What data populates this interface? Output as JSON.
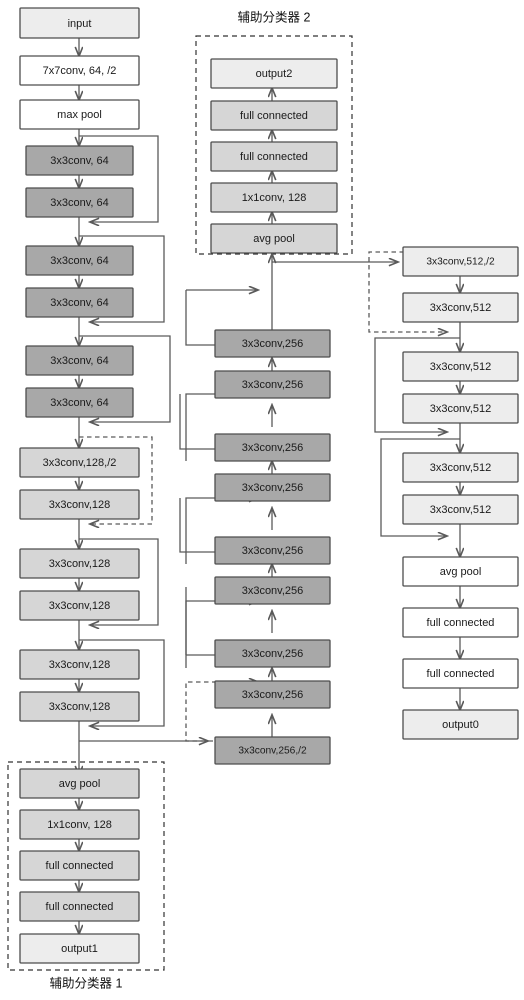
{
  "figure": {
    "type": "neural-network-architecture-diagram",
    "background_color": "#ffffff",
    "colors": {
      "box_light": "#ededed",
      "box_mid": "#d6d6d6",
      "box_dark": "#a8a8a8",
      "box_white": "#ffffff",
      "border": "#4d4d4d",
      "edge": "#5a5a5a",
      "text": "#1a1a1a"
    }
  },
  "titles": {
    "aux2": "辅助分类器 2",
    "aux1": "辅助分类器 1"
  },
  "main_column": {
    "name": "main-backbone-stem",
    "nodes": [
      {
        "id": "input",
        "label": "input",
        "style": "light"
      },
      {
        "id": "conv7x7",
        "label": "7x7conv, 64, /2",
        "style": "white"
      },
      {
        "id": "maxpool",
        "label": "max pool",
        "style": "white"
      },
      {
        "id": "c64_1",
        "label": "3x3conv, 64",
        "style": "dark"
      },
      {
        "id": "c64_2",
        "label": "3x3conv, 64",
        "style": "dark"
      },
      {
        "id": "c64_3",
        "label": "3x3conv, 64",
        "style": "dark"
      },
      {
        "id": "c64_4",
        "label": "3x3conv, 64",
        "style": "dark"
      },
      {
        "id": "c64_5",
        "label": "3x3conv, 64",
        "style": "dark"
      },
      {
        "id": "c64_6",
        "label": "3x3conv, 64",
        "style": "dark"
      },
      {
        "id": "c128_1",
        "label": "3x3conv,128,/2",
        "style": "mid"
      },
      {
        "id": "c128_2",
        "label": "3x3conv,128",
        "style": "mid"
      },
      {
        "id": "c128_3",
        "label": "3x3conv,128",
        "style": "mid"
      },
      {
        "id": "c128_4",
        "label": "3x3conv,128",
        "style": "mid"
      },
      {
        "id": "c128_5",
        "label": "3x3conv,128",
        "style": "mid"
      },
      {
        "id": "c128_6",
        "label": "3x3conv,128",
        "style": "mid"
      }
    ]
  },
  "middle_column": {
    "name": "stage3-256-column",
    "flow_direction": "bottom-to-top",
    "nodes": [
      {
        "id": "m256_1",
        "label": "3x3conv,256",
        "style": "dark"
      },
      {
        "id": "m256_2",
        "label": "3x3conv,256",
        "style": "dark"
      },
      {
        "id": "m256_3",
        "label": "3x3conv,256",
        "style": "dark"
      },
      {
        "id": "m256_4",
        "label": "3x3conv,256",
        "style": "dark"
      },
      {
        "id": "m256_5",
        "label": "3x3conv,256",
        "style": "dark"
      },
      {
        "id": "m256_6",
        "label": "3x3conv,256",
        "style": "dark"
      },
      {
        "id": "m256_7",
        "label": "3x3conv,256",
        "style": "dark"
      },
      {
        "id": "m256_8",
        "label": "3x3conv,256,/2",
        "style": "dark"
      }
    ]
  },
  "right_column": {
    "name": "stage4-512-column",
    "nodes": [
      {
        "id": "r512_1",
        "label": "3x3conv,512,/2",
        "style": "light"
      },
      {
        "id": "r512_2",
        "label": "3x3conv,512",
        "style": "light"
      },
      {
        "id": "r512_3",
        "label": "3x3conv,512",
        "style": "light"
      },
      {
        "id": "r512_4",
        "label": "3x3conv,512",
        "style": "light"
      },
      {
        "id": "r512_5",
        "label": "3x3conv,512",
        "style": "light"
      },
      {
        "id": "r512_6",
        "label": "3x3conv,512",
        "style": "light"
      },
      {
        "id": "r_avgpool",
        "label": "avg pool",
        "style": "white"
      },
      {
        "id": "r_fc1",
        "label": "full connected",
        "style": "white"
      },
      {
        "id": "r_fc2",
        "label": "full connected",
        "style": "white"
      },
      {
        "id": "output0",
        "label": "output0",
        "style": "light"
      }
    ]
  },
  "aux_classifier_2": {
    "name": "auxiliary-classifier-2",
    "title": "辅助分类器 2",
    "flow_direction": "bottom-to-top",
    "nodes": [
      {
        "id": "a2_avgpool",
        "label": "avg pool",
        "style": "mid"
      },
      {
        "id": "a2_conv1x1",
        "label": "1x1conv, 128",
        "style": "mid"
      },
      {
        "id": "a2_fc1",
        "label": "full connected",
        "style": "mid"
      },
      {
        "id": "a2_fc2",
        "label": "full connected",
        "style": "mid"
      },
      {
        "id": "a2_output",
        "label": "output2",
        "style": "light"
      }
    ]
  },
  "aux_classifier_1": {
    "name": "auxiliary-classifier-1",
    "title": "辅助分类器 1",
    "flow_direction": "top-to-bottom",
    "nodes": [
      {
        "id": "a1_avgpool",
        "label": "avg pool",
        "style": "mid"
      },
      {
        "id": "a1_conv1x1",
        "label": "1x1conv, 128",
        "style": "mid"
      },
      {
        "id": "a1_fc1",
        "label": "full connected",
        "style": "mid"
      },
      {
        "id": "a1_fc2",
        "label": "full connected",
        "style": "mid"
      },
      {
        "id": "a1_output",
        "label": "output1",
        "style": "light"
      }
    ]
  }
}
